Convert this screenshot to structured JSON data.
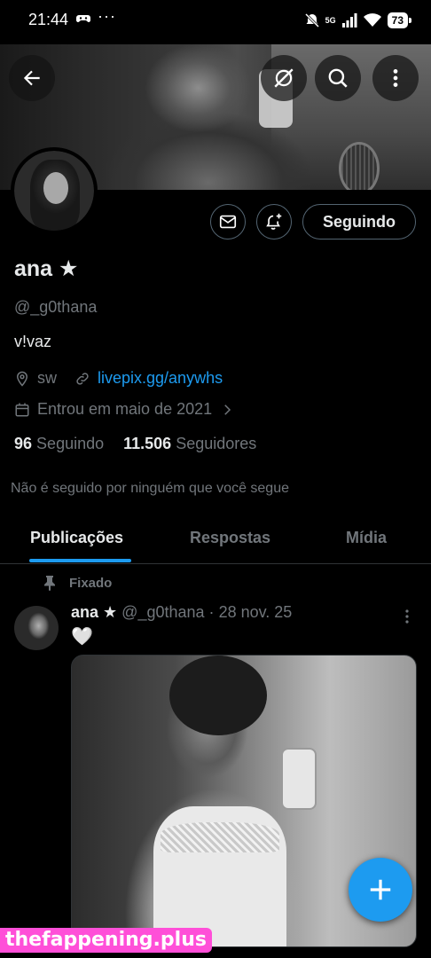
{
  "status_bar": {
    "time": "21:44",
    "more": "···",
    "network": "5G",
    "battery": "73"
  },
  "header": {
    "back_icon": "arrow-left-icon",
    "grok_icon": "grok-icon",
    "search_icon": "search-icon",
    "more_icon": "more-vertical-icon"
  },
  "profile": {
    "name": "ana ★",
    "handle": "@_g0thana",
    "bio": "v!vaz",
    "location": "sw",
    "link": "livepix.gg/anywhs",
    "joined": "Entrou em maio de 2021",
    "following_count": "96",
    "following_label": "Seguindo",
    "followers_count": "11.506",
    "followers_label": "Seguidores",
    "not_followed_text": "Não é seguido por ninguém que você segue",
    "follow_button_label": "Seguindo"
  },
  "tabs": [
    {
      "label": "Publicações",
      "active": true
    },
    {
      "label": "Respostas",
      "active": false
    },
    {
      "label": "Mídia",
      "active": false
    }
  ],
  "pinned_post": {
    "pinned_label": "Fixado",
    "author_name": "ana ★",
    "author_handle": "@_g0thana",
    "separator": "·",
    "date": "28 nov. 25",
    "text": "🤍"
  },
  "watermark": "thefappening.plus",
  "colors": {
    "accent": "#1d9bf0",
    "background": "#000000",
    "muted_text": "#71767b",
    "primary_text": "#e7e9ea",
    "watermark_bg": "#ff4fd8"
  }
}
